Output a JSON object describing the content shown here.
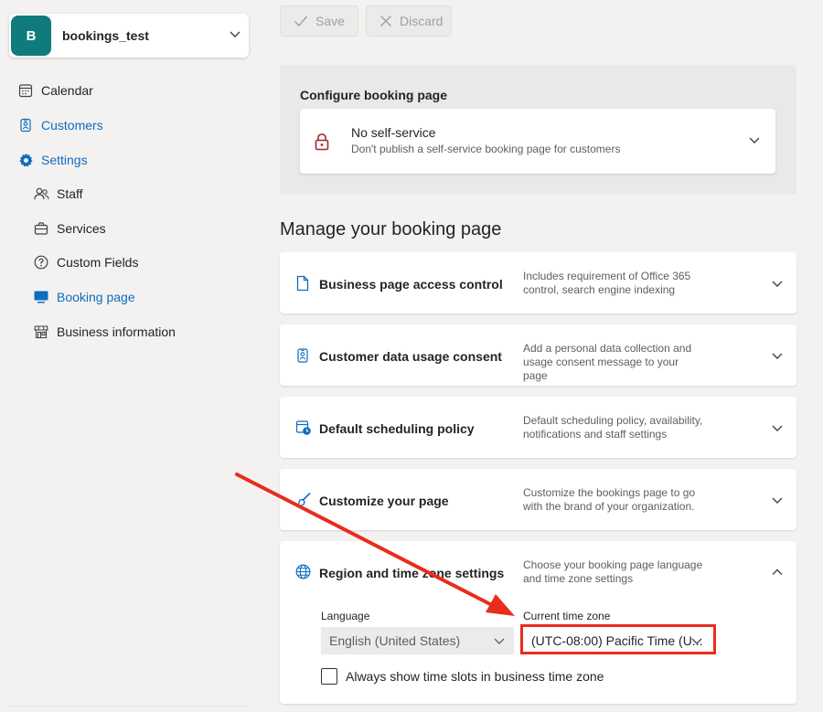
{
  "business": {
    "avatar_letter": "B",
    "name": "bookings_test"
  },
  "sidebar": {
    "items": [
      {
        "label": "Calendar"
      },
      {
        "label": "Customers"
      },
      {
        "label": "Settings"
      },
      {
        "label": "Staff"
      },
      {
        "label": "Services"
      },
      {
        "label": "Custom Fields"
      },
      {
        "label": "Booking page"
      },
      {
        "label": "Business information"
      }
    ]
  },
  "toolbar": {
    "save_label": "Save",
    "discard_label": "Discard"
  },
  "configure": {
    "title": "Configure booking page",
    "mode_title": "No self-service",
    "mode_desc": "Don't publish a self-service booking page for customers"
  },
  "manage": {
    "heading": "Manage your booking page",
    "sections": [
      {
        "title": "Business page access control",
        "desc1": "Includes requirement of Office 365",
        "desc2": "control, search engine indexing"
      },
      {
        "title": "Customer data usage consent",
        "desc1": "Add a personal data collection and",
        "desc2": "usage consent message to your page"
      },
      {
        "title": "Default scheduling policy",
        "desc1": "Default scheduling policy, availability,",
        "desc2": "notifications and staff settings"
      },
      {
        "title": "Customize your page",
        "desc1": "Customize the bookings page to go",
        "desc2": "with the brand of your organization."
      },
      {
        "title": "Region and time zone settings",
        "desc1": "Choose your booking page language",
        "desc2": "and time zone settings"
      }
    ]
  },
  "region": {
    "language_label": "Language",
    "language_value": "English (United States)",
    "timezone_label": "Current time zone",
    "timezone_value": "(UTC-08:00) Pacific Time (U...",
    "checkbox_label": "Always show time slots in business time zone"
  },
  "colors": {
    "accent": "#0f6cbd",
    "avatar": "#0f7b7c",
    "annotation": "#e82d1d",
    "lock": "#a4262c"
  }
}
